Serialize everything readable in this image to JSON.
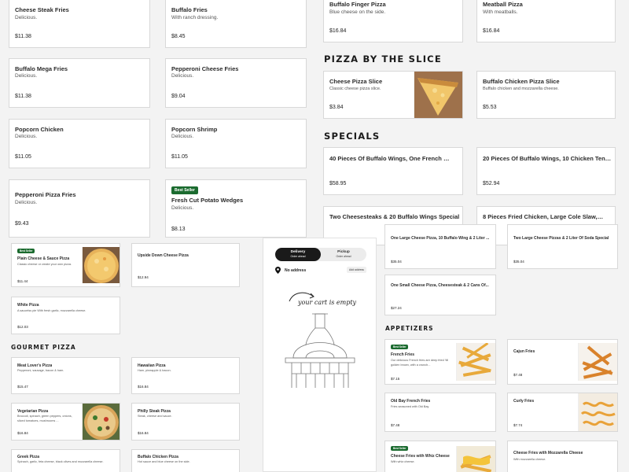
{
  "top_left_grid": [
    {
      "name": "Cheese Steak Fries",
      "desc": "Delicious.",
      "price": "$11.38"
    },
    {
      "name": "Buffalo Fries",
      "desc": "With ranch dressing.",
      "price": "$8.45"
    },
    {
      "name": "Buffalo Mega Fries",
      "desc": "Delicious.",
      "price": "$11.38"
    },
    {
      "name": "Pepperoni Cheese Fries",
      "desc": "Delicious.",
      "price": "$9.04"
    },
    {
      "name": "Popcorn Chicken",
      "desc": "Delicious.",
      "price": "$11.05"
    },
    {
      "name": "Popcorn Shrimp",
      "desc": "Delicious.",
      "price": "$11.05"
    },
    {
      "name": "Pepperoni Pizza Fries",
      "desc": "Delicious.",
      "price": "$9.43"
    },
    {
      "name": "Fresh Cut Potato Wedges",
      "desc": "Delicious.",
      "price": "$8.13",
      "badge": "Best Seller"
    }
  ],
  "top_right_top": [
    {
      "name": "Buffalo Finger Pizza",
      "desc": "Blue cheese on the side.",
      "price": "$16.84"
    },
    {
      "name": "Meatball Pizza",
      "desc": "With meatballs.",
      "price": "$16.84"
    }
  ],
  "sections": {
    "pizza_by_slice": "Pizza by the Slice",
    "specials": "Specials",
    "gourmet": "Gourmet Pizza",
    "appetizers": "Appetizers"
  },
  "slice_items": [
    {
      "name": "Cheese Pizza Slice",
      "desc": "Classic cheese pizza slice.",
      "price": "$3.84"
    },
    {
      "name": "Buffalo Chicken Pizza Slice",
      "desc": "Buffalo chicken and mozzarella cheese.",
      "price": "$5.53"
    }
  ],
  "specials": [
    {
      "name": "40 Pieces Of Buffalo Wings, One French Fries & 2...",
      "price": "$58.95"
    },
    {
      "name": "20 Pieces Of Buffalo Wings, 10 Chicken Tenders, O...",
      "price": "$52.94"
    },
    {
      "name": "Two Cheesesteaks & 20 Buffalo Wings Special"
    },
    {
      "name": "8 Pieces Fried Chicken, Large Cole Slaw, French..."
    }
  ],
  "bottom_left": [
    {
      "name": "Plain Cheese & Sauce Pizza",
      "desc": "Classic cheese or create your own pizza.",
      "price": "$11.44",
      "badge": "Best Seller"
    },
    {
      "name": "Upside Down Cheese Pizza",
      "desc": "",
      "price": "$12.94"
    },
    {
      "name": "White Pizza",
      "desc": "A saucelss pie With fresh garlic, mozzarella cheese.",
      "price": "$12.03"
    }
  ],
  "gourmet_items": [
    {
      "name": "Meat Lover's Pizza",
      "desc": "Pepperoni, sausage, bacon & ham.",
      "price": "$15.47"
    },
    {
      "name": "Hawaiian Pizza",
      "desc": "Ham, pineapple & bacon.",
      "price": "$16.84"
    },
    {
      "name": "Vegetarian Pizza",
      "desc": "Broccoli, spinach, green peppers, onions, sliced tomatoes, mushrooms ...",
      "price": "$16.84"
    },
    {
      "name": "Philly Steak Pizza",
      "desc": "Steak, cheese and sauce.",
      "price": "$16.84"
    },
    {
      "name": "Greek Pizza",
      "desc": "Spinach, garlic, feta cheese, black olives and mozzarella cheese.",
      "price": ""
    },
    {
      "name": "Buffalo Chicken Pizza",
      "desc": "Hot sauce and blue cheese on the side.",
      "price": ""
    }
  ],
  "cart": {
    "delivery": "Delivery",
    "delivery_sub": "Order ahead",
    "pickup": "Pickup",
    "pickup_sub": "Order ahead",
    "address": "No address",
    "add_address": "Add address",
    "empty": "your cart is empty"
  },
  "bottom_right_specials": [
    {
      "name": "One Large Cheese Pizza, 10 Buffalo Wing & 2 Liter ...",
      "price": "$35.04"
    },
    {
      "name": "Two Large Cheese Pizzas & 2 Liter Of Soda Special",
      "price": "$35.04"
    },
    {
      "name": "One Small Cheese Pizza, Cheesesteak & 2 Cans Of...",
      "price": "$27.24"
    }
  ],
  "appetizers": [
    {
      "name": "French Fries",
      "desc": "Our delicious French fries are deep fried 'till golden brown, with a crunch...",
      "price": "$7.15",
      "badge": "Best Seller"
    },
    {
      "name": "Cajun Fries",
      "desc": "",
      "price": "$7.48"
    },
    {
      "name": "Old Bay French Fries",
      "desc": "Fries seasoned with Old Bay.",
      "price": "$7.48"
    },
    {
      "name": "Curly Fries",
      "desc": "",
      "price": "$7.74"
    },
    {
      "name": "Cheese Fries with Whiz Cheese",
      "desc": "With whiz cheese.",
      "price": "",
      "badge": "Best Seller"
    },
    {
      "name": "Cheese Fries with Mozzarella Cheese",
      "desc": "With mozzarella cheese.",
      "price": ""
    }
  ],
  "colors": {
    "accent_badge": "#1b6b2f",
    "toggle_active": "#1a1a1a",
    "fries": "#e8a93a"
  }
}
